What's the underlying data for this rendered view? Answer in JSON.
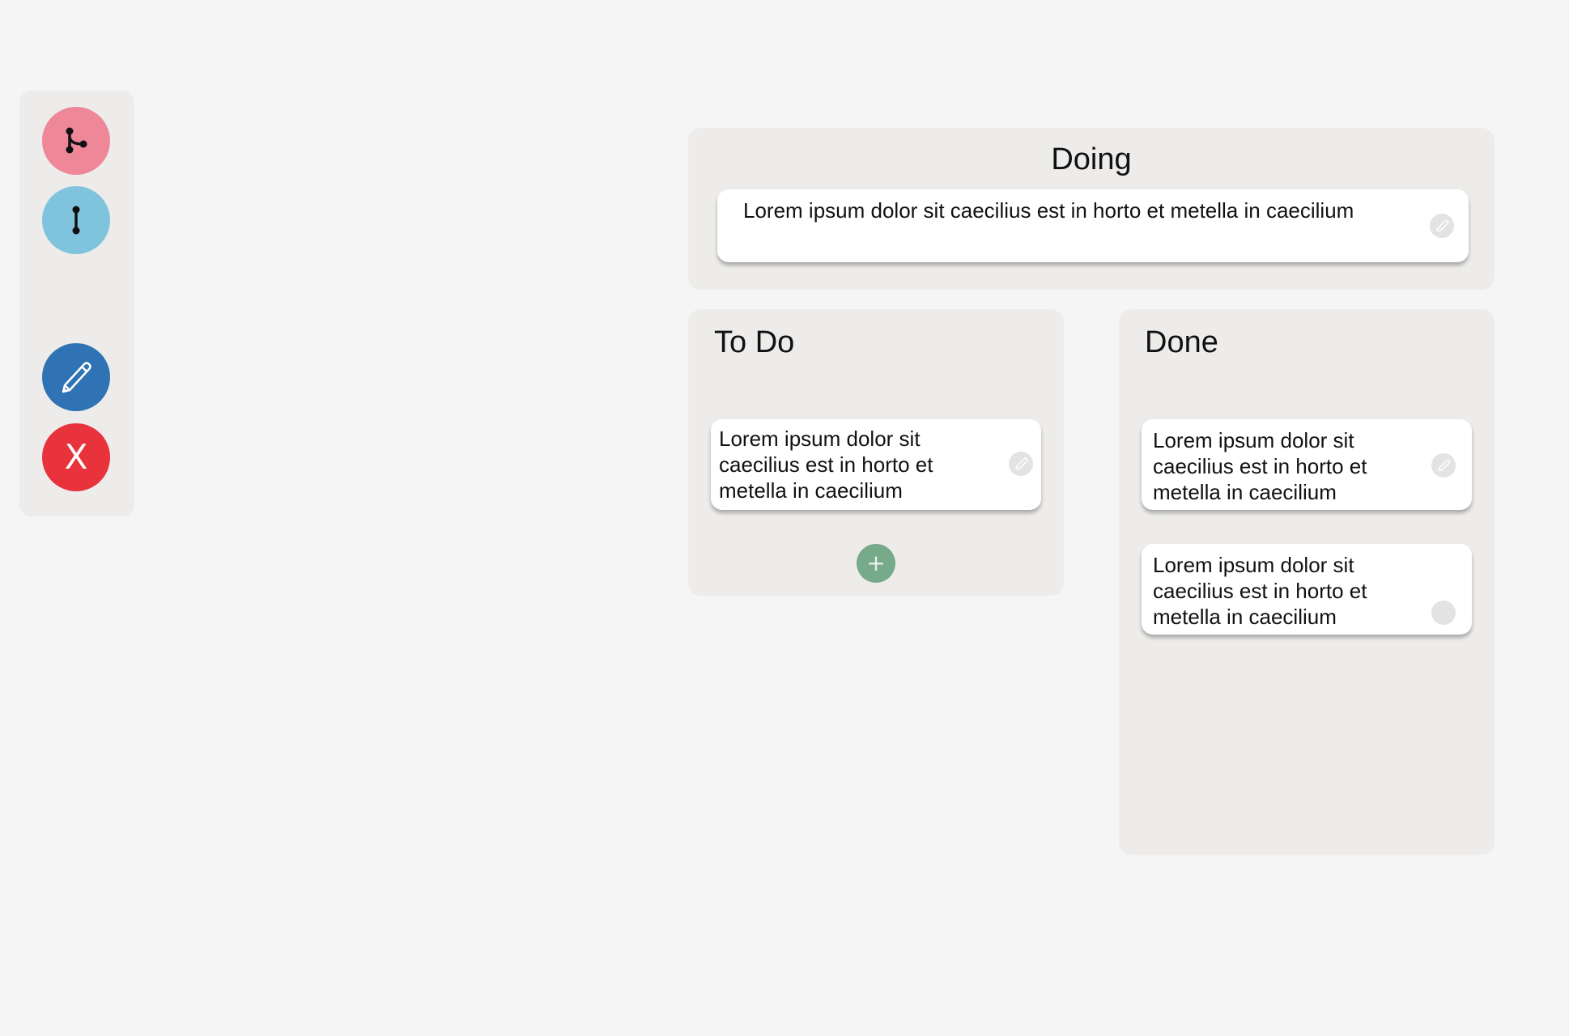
{
  "toolbar": {
    "tools": [
      {
        "id": "branch",
        "icon": "branch-icon",
        "color": "#ee8797"
      },
      {
        "id": "link",
        "icon": "link-icon",
        "color": "#80c3dc"
      },
      {
        "id": "edit",
        "icon": "pencil-icon",
        "color": "#2f73b4"
      },
      {
        "id": "close",
        "icon": "close-icon",
        "label": "X",
        "color": "#e8323c"
      }
    ]
  },
  "board": {
    "doing": {
      "title": "Doing",
      "cards": [
        {
          "text": "Lorem ipsum dolor sit caecilius est in horto et metella in caecilium",
          "toggle_icon": "pencil-icon"
        }
      ]
    },
    "todo": {
      "title": "To Do",
      "cards": [
        {
          "text": "Lorem ipsum dolor sit caecilius est in horto et metella in caecilium",
          "toggle_icon": "pencil-icon"
        }
      ],
      "add_label": "+"
    },
    "done": {
      "title": "Done",
      "cards": [
        {
          "text": "Lorem ipsum dolor sit caecilius est in horto et metella in caecilium",
          "toggle_icon": "pencil-icon"
        },
        {
          "text": "Lorem ipsum dolor sit caecilius est in horto et metella in caecilium",
          "toggle_icon": "circle-icon"
        }
      ]
    }
  },
  "colors": {
    "background": "#f5f5f5",
    "panel": "#edecea",
    "card": "#ffffff",
    "add_button": "#77a98b"
  }
}
